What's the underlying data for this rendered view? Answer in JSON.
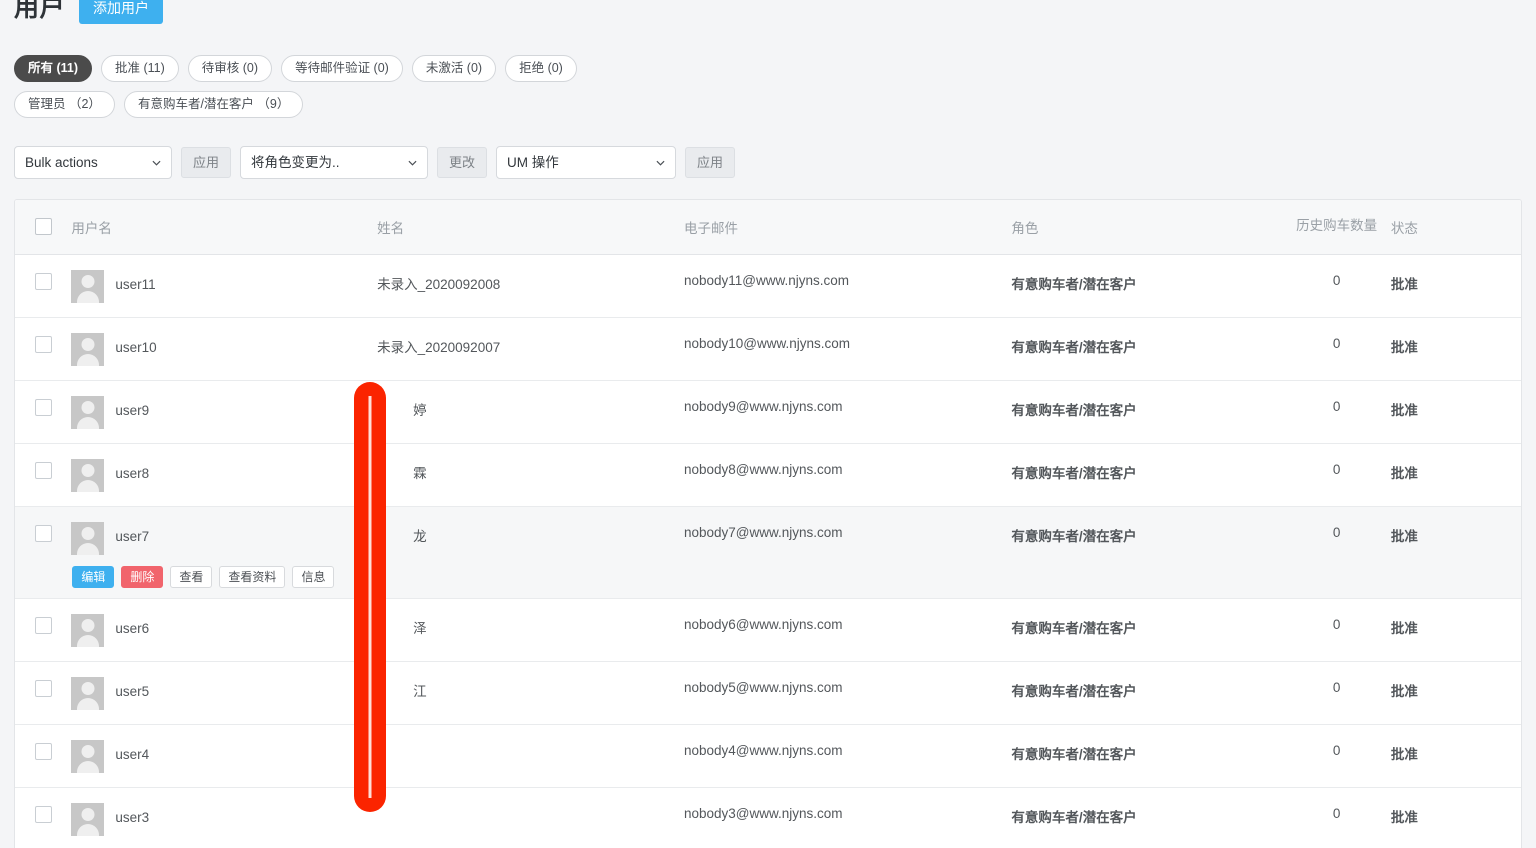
{
  "header": {
    "title": "用户",
    "add_user_label": "添加用户"
  },
  "filters": {
    "row1": [
      {
        "label": "所有 (11)",
        "active": true
      },
      {
        "label": "批准 (11)",
        "active": false
      },
      {
        "label": "待审核 (0)",
        "active": false
      },
      {
        "label": "等待邮件验证 (0)",
        "active": false
      },
      {
        "label": "未激活 (0)",
        "active": false
      },
      {
        "label": "拒绝 (0)",
        "active": false
      }
    ],
    "row2": [
      {
        "label": "管理员 （2）",
        "active": false
      },
      {
        "label": "有意购车者/潜在客户 （9）",
        "active": false
      }
    ]
  },
  "toolbar": {
    "bulk_actions_value": "Bulk actions",
    "apply_label_1": "应用",
    "change_role_value": "将角色变更为..",
    "change_label": "更改",
    "um_actions_value": "UM 操作",
    "apply_label_2": "应用"
  },
  "table": {
    "columns": {
      "username": "用户名",
      "name": "姓名",
      "email": "电子邮件",
      "role": "角色",
      "purchase_count": "历史购车数量",
      "status": "状态"
    },
    "row_actions": {
      "edit": "编辑",
      "delete": "删除",
      "view": "查看",
      "view_profile": "查看资料",
      "info": "信息"
    },
    "rows": [
      {
        "username": "user11",
        "name": "未录入_2020092008",
        "email": "nobody11@www.njyns.com",
        "role": "有意购车者/潜在客户",
        "purchase_count": "0",
        "status": "批准",
        "hovered": false,
        "name_obscured": false
      },
      {
        "username": "user10",
        "name": "未录入_2020092007",
        "email": "nobody10@www.njyns.com",
        "role": "有意购车者/潜在客户",
        "purchase_count": "0",
        "status": "批准",
        "hovered": false,
        "name_obscured": false
      },
      {
        "username": "user9",
        "name": "婷",
        "email": "nobody9@www.njyns.com",
        "role": "有意购车者/潜在客户",
        "purchase_count": "0",
        "status": "批准",
        "hovered": false,
        "name_obscured": true
      },
      {
        "username": "user8",
        "name": "霖",
        "email": "nobody8@www.njyns.com",
        "role": "有意购车者/潜在客户",
        "purchase_count": "0",
        "status": "批准",
        "hovered": false,
        "name_obscured": true
      },
      {
        "username": "user7",
        "name": "龙",
        "email": "nobody7@www.njyns.com",
        "role": "有意购车者/潜在客户",
        "purchase_count": "0",
        "status": "批准",
        "hovered": true,
        "name_obscured": true
      },
      {
        "username": "user6",
        "name": "泽",
        "email": "nobody6@www.njyns.com",
        "role": "有意购车者/潜在客户",
        "purchase_count": "0",
        "status": "批准",
        "hovered": false,
        "name_obscured": true
      },
      {
        "username": "user5",
        "name": "江",
        "email": "nobody5@www.njyns.com",
        "role": "有意购车者/潜在客户",
        "purchase_count": "0",
        "status": "批准",
        "hovered": false,
        "name_obscured": true
      },
      {
        "username": "user4",
        "name": "",
        "email": "nobody4@www.njyns.com",
        "role": "有意购车者/潜在客户",
        "purchase_count": "0",
        "status": "批准",
        "hovered": false,
        "name_obscured": true
      },
      {
        "username": "user3",
        "name": "",
        "email": "nobody3@www.njyns.com",
        "role": "有意购车者/潜在客户",
        "purchase_count": "0",
        "status": "批准",
        "hovered": false,
        "name_obscured": true
      }
    ]
  },
  "annotation": {
    "shape": "red-vertical-highlight-bar",
    "color": "#fb2400"
  }
}
